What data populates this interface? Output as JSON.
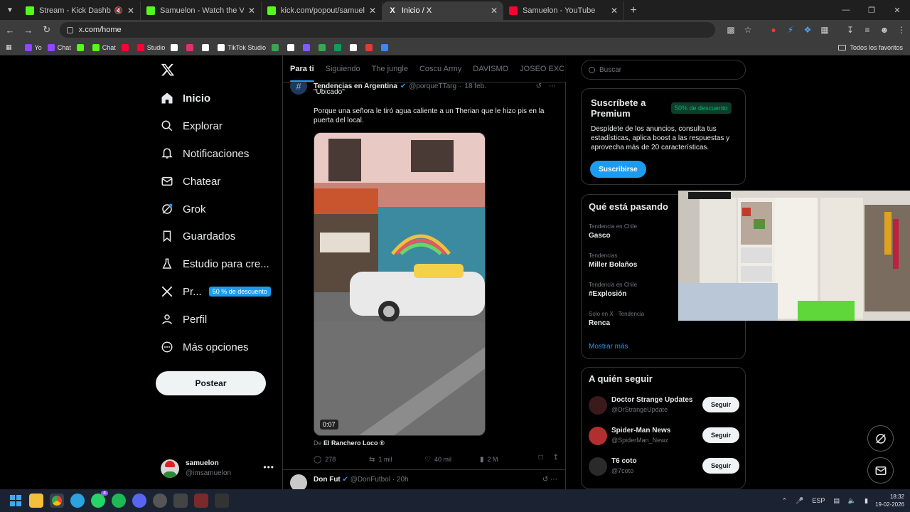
{
  "browser": {
    "tabs": [
      {
        "title": "Stream - Kick Dashboard",
        "favicon_color": "#53fc18",
        "muted": true
      },
      {
        "title": "Samuelon - Watch the VOD on",
        "favicon_color": "#53fc18"
      },
      {
        "title": "kick.com/popout/samuelon/ch",
        "favicon_color": "#53fc18"
      },
      {
        "title": "Inicio / X",
        "favicon_color": "#ffffff",
        "active": true
      },
      {
        "title": "Samuelon - YouTube",
        "favicon_color": "#ff0033"
      }
    ],
    "url": "x.com/home",
    "bookmarks": [
      {
        "label": "Yo",
        "color": "#9146ff"
      },
      {
        "label": "Chat",
        "color": "#9146ff"
      },
      {
        "label": "",
        "color": "#53fc18"
      },
      {
        "label": "Chat",
        "color": "#53fc18"
      },
      {
        "label": "",
        "color": "#ff0033"
      },
      {
        "label": "Studio",
        "color": "#ff0033"
      },
      {
        "label": "",
        "color": "#ffffff"
      },
      {
        "label": "",
        "color": "#e1306c"
      },
      {
        "label": "",
        "color": "#ffffff"
      },
      {
        "label": "TikTok Studio",
        "color": "#ffffff"
      },
      {
        "label": "",
        "color": "#34a853"
      },
      {
        "label": "",
        "color": "#ffffff"
      },
      {
        "label": "",
        "color": "#7c5cff"
      },
      {
        "label": "",
        "color": "#34a853"
      },
      {
        "label": "",
        "color": "#0f9d58"
      },
      {
        "label": "",
        "color": "#ffffff"
      },
      {
        "label": "",
        "color": "#e53935"
      },
      {
        "label": "",
        "color": "#4285f4"
      }
    ],
    "all_bookmarks": "Todos los favoritos"
  },
  "nav": {
    "items": [
      {
        "label": "Inicio",
        "icon": "home-icon"
      },
      {
        "label": "Explorar",
        "icon": "search-icon"
      },
      {
        "label": "Notificaciones",
        "icon": "bell-icon"
      },
      {
        "label": "Chatear",
        "icon": "mail-icon"
      },
      {
        "label": "Grok",
        "icon": "grok-icon"
      },
      {
        "label": "Guardados",
        "icon": "bookmark-icon"
      },
      {
        "label": "Estudio para cre...",
        "icon": "flask-icon"
      },
      {
        "label": "Pr...",
        "icon": "x-premium-icon",
        "badge": "50 % de descuento"
      },
      {
        "label": "Perfil",
        "icon": "person-icon"
      },
      {
        "label": "Más opciones",
        "icon": "more-circle-icon"
      }
    ],
    "post_button": "Postear",
    "account": {
      "name": "samuelon",
      "handle": "@imsamuelon"
    }
  },
  "feed": {
    "tabs": [
      "Para ti",
      "Siguiendo",
      "The jungle",
      "Coscu Army",
      "DAVISMO",
      "JOSEO EXC"
    ],
    "tweet": {
      "author": "Tendencias en Argentina",
      "handle": "@porqueTTarg",
      "time": "18 feb.",
      "quote": "\"Ubicado\"",
      "text": "Porque una señora le tiró agua caliente a un Therian que le hizo pis en la puerta del local.",
      "video_duration": "0:07",
      "from_prefix": "De",
      "from_account": "El Ranchero Loco ®",
      "replies": "278",
      "reposts": "1 mil",
      "likes": "40 mil",
      "views": "2 M"
    },
    "tweet2": {
      "author": "Don Fut",
      "handle": "@DonFutbol",
      "time": "20h"
    }
  },
  "sidebar": {
    "search_placeholder": "Buscar",
    "premium": {
      "title": "Suscríbete a Premium",
      "badge": "50% de descuento",
      "body": "Despídete de los anuncios, consulta tus estadísticas, aplica boost a las respuestas y aprovecha más de 20 características.",
      "button": "Suscribirse"
    },
    "trends": {
      "title": "Qué está pasando",
      "items": [
        {
          "category": "Tendencia en Chile",
          "name": "Gasco"
        },
        {
          "category": "Tendencias",
          "name": "Miller Bolaños"
        },
        {
          "category": "Tendencia en Chile",
          "name": "#Explosión"
        },
        {
          "category": "Solo en X · Tendencia",
          "name": "Renca"
        }
      ],
      "show_more": "Mostrar más"
    },
    "who_to_follow": {
      "title": "A quién seguir",
      "accounts": [
        {
          "name": "Doctor Strange Updates",
          "handle": "@DrStrangeUpdate",
          "button": "Seguir"
        },
        {
          "name": "Spider-Man News",
          "handle": "@SpiderMan_Newz",
          "button": "Seguir"
        },
        {
          "name": "T6 coto",
          "handle": "@7coto",
          "button": "Seguir"
        }
      ]
    }
  },
  "taskbar": {
    "language": "ESP",
    "time": "18:32",
    "date": "19-02-2026",
    "whatsapp_badge": "4"
  }
}
